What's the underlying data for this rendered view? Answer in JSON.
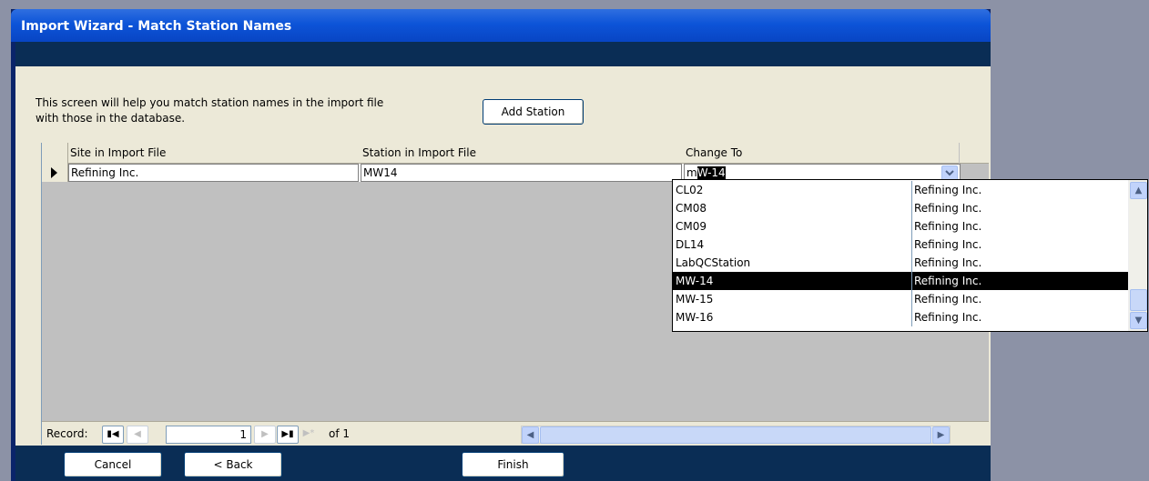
{
  "window": {
    "title": "Import Wizard - Match Station Names"
  },
  "intro": {
    "line1": "This screen will help you match station names in the import file",
    "line2": "with those in the database."
  },
  "buttons": {
    "add_station": "Add Station",
    "cancel": "Cancel",
    "back": "< Back",
    "finish": "Finish"
  },
  "grid": {
    "headers": [
      "Site in Import File",
      "Station in Import File",
      "Change To"
    ],
    "row": {
      "site": "Refining Inc.",
      "station": "MW14",
      "change_to_typed": "m",
      "change_to_selected": "W-14"
    }
  },
  "dropdown": {
    "items": [
      {
        "station": "CL02",
        "site": "Refining Inc."
      },
      {
        "station": "CM08",
        "site": "Refining Inc."
      },
      {
        "station": "CM09",
        "site": "Refining Inc."
      },
      {
        "station": "DL14",
        "site": "Refining Inc."
      },
      {
        "station": "LabQCStation",
        "site": "Refining Inc."
      },
      {
        "station": "MW-14",
        "site": "Refining Inc."
      },
      {
        "station": "MW-15",
        "site": "Refining Inc."
      },
      {
        "station": "MW-16",
        "site": "Refining Inc."
      }
    ],
    "selected_index": 5
  },
  "record_nav": {
    "label": "Record:",
    "current": "1",
    "of_label": "of 1"
  },
  "icons": {
    "first": "first-record-icon",
    "prev": "prev-record-icon",
    "next": "next-record-icon",
    "last": "last-record-icon",
    "new": "new-record-icon",
    "dropdown": "chevron-down-icon",
    "row_selector": "current-row-arrow-icon"
  },
  "colors": {
    "titlebar": "#0d54d8",
    "dark_band": "#0a2d55",
    "panel": "#ece9d8",
    "grid_bg": "#c0c0c0",
    "desktop": "#8c92a6"
  }
}
